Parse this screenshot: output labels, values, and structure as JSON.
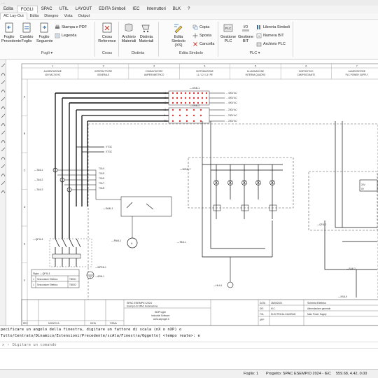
{
  "title_text": "…",
  "menu": {
    "items": [
      "Edita",
      "FOGLI",
      "SPAC",
      "UTIL",
      "LAYOUT",
      "EDITA Simboli",
      "IEC",
      "Interruttori",
      "BLK",
      "?"
    ],
    "selected_index": 1
  },
  "ribbon_tabs": {
    "items": [
      "AC Lay-Out",
      "Edita",
      "Disegno",
      "Vista",
      "Output"
    ],
    "selected_index": 0
  },
  "ribbon": {
    "tools": {
      "foglio_precedente": "Foglio Precedente",
      "cambio_foglio": "Cambio Foglio",
      "foglio_seguente": "Foglio Seguente",
      "stampa_pdf": "Stampa e PDF",
      "legenda": "Legenda",
      "cross_reference": "Cross Reference",
      "archivio_materiali": "Archivio Materiali",
      "distinta_materiali": "Distinta Materiali",
      "edita_simbolo": "Edita Simbolo (XS)",
      "copia": "Copia",
      "sposta": "Sposta",
      "cancella": "Cancella",
      "gestione_plc": "Gestione PLC",
      "gestione_bit": "Gestione BIT",
      "libreria_simboli": "Libreria Simboli",
      "numera_bit": "Numera BIT",
      "archivio_plc": "Archivio PLC"
    },
    "groups": {
      "fogli": "Fogli",
      "cross": "Cross",
      "distinta": "Distinta",
      "edita_simbolo": "Edita Simbolo",
      "plc": "PLC"
    }
  },
  "drawing": {
    "columns": [
      "1",
      "2",
      "3",
      "4",
      "5",
      "6",
      "7"
    ],
    "rows": [
      "A",
      "B",
      "C",
      "D",
      "E",
      "F"
    ],
    "headers": [
      {
        "label": "ALIMENTAZIONE",
        "value": "400 VAC 50 HZ"
      },
      {
        "label": "INTERRUTTORE",
        "value": "GENERALE"
      },
      {
        "label": "COMMUTATORE",
        "value": "AMPEROMETRICO"
      },
      {
        "label": "DISTRIBUZIONE",
        "value": "L1 / L2 / L3 / PE"
      },
      {
        "label": "ILLUMINAZIONE",
        "value": "INTERNA QUADRO"
      },
      {
        "label": "DISPOSITIVO",
        "value": "CAMPEGGIANTE"
      },
      {
        "label": "ALIMENTATORE",
        "value": "PLC POWER SUPPLY"
      }
    ],
    "tags": {
      "xs_top": "—XS4L1",
      "tag_l1": "L1",
      "tag_l2": "L2",
      "tag_l3": "L3",
      "ref_3_1": "→ 400V AC",
      "ref_3_2": "→ 400V AC",
      "ref_3_3": "→ 400V AC",
      "xs_mid": "—XS4L2",
      "tag_l1n": "L1",
      "tag_n": "N",
      "tag_pe": "PE",
      "ref_230_1": "→ 230V AC",
      "ref_230_2": "→ 230V AC",
      "ref_230_3": "→ 230V AC",
      "ta_a": "—TA4L1",
      "ta_b": "—TA4L2",
      "ta_c": "—TA4L3",
      "ref_b1": "T01/4",
      "ref_b2": "T01/5",
      "ref_b3": "T01/6",
      "ref_b4": "T01/7",
      "ref_b5": "T01/8",
      "out_a": "XT/3C",
      "out_b": "XT/3C",
      "sa": "—SA4L1",
      "pa": "—PA4L1",
      "qf": "—QF4L1",
      "wpe": "—WPE4L1",
      "ar": "—AR4L1",
      "wm": "—WS4L7",
      "hl": "—HL4L1",
      "tb": "—TB4L1",
      "qfr": "—QF4L2",
      "sar": "—SA4L2",
      "xsr": "—XS4L9",
      "meter": "A",
      "dim_a": "24V",
      "dim_b": "0V"
    },
    "legend_table": {
      "title": "Sigla: —QF4L1",
      "rows": [
        {
          "n": "1",
          "desc": "Sezionatore Elettrico",
          "code": "TBD01"
        },
        {
          "n": "1",
          "desc": "Sezionatore Elettrico",
          "code": "TBD02"
        }
      ]
    },
    "title_block": {
      "rev_labels": [
        "REV",
        "MODIFICA",
        "DATA",
        "FIRMA"
      ],
      "project_label": "SPAC ESEMPIO 2024",
      "project_desc": "Esempio di SPAC Automazione",
      "company": "SDProget",
      "company_sub": "Industrial Software",
      "website": "www.sdproget.it",
      "data_label": "DATA",
      "date": "26/08/2023",
      "dis_label": "DIS",
      "dis_value": "M.C.",
      "fgl_label": "FGL",
      "fgl_value": "ELECTRICAL DIAGRAM",
      "app_label": "APP",
      "sheet_label": "Foglio",
      "sheet_value": "4",
      "desc_title": "Schema Elettrico",
      "desc_l1": "Alimentazione generale",
      "desc_l2": "Main Power Supply"
    }
  },
  "command": {
    "line1": "pecificare un angolo della finestra, digitare un fattore di scala (nX o nXP) o",
    "line2": "Tutto/Centrato/Dinamico/Estensioni/Precedente/scAla/Finestra/Oggetto] <tempo reale>: e",
    "input_placeholder": "Digitare un comando"
  },
  "status": {
    "foglio": "Foglio: 1",
    "progetto": "Progetto: SPAC ESEMPIO 2024 - IEC",
    "coords": "559.68, 4.42, 0.00"
  },
  "colors": {
    "menu_bg": "#f3f3f3",
    "ribbon_bg": "#fbfbfb",
    "wire": "#111111",
    "gray": "#9a9a9a",
    "blue_accent": "#2b6cb0",
    "red_accent": "#c0392b"
  }
}
